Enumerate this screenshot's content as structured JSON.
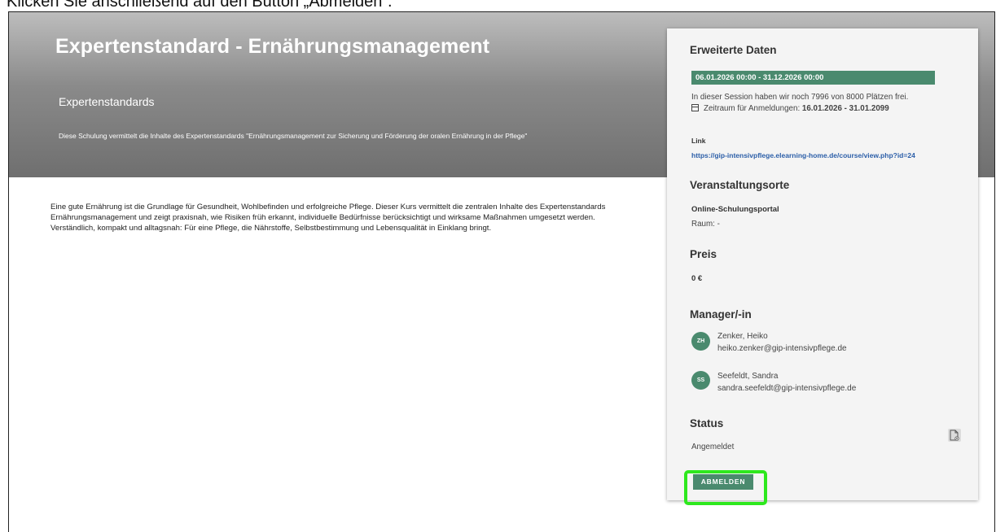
{
  "instruction": "Klicken Sie anschließend auf den Button „Abmelden“.",
  "hero": {
    "title": "Expertenstandard - Ernährungsmanagement",
    "subtitle": "Expertenstandards",
    "description": "Diese Schulung vermittelt die Inhalte des Expertenstandards \"Ernährungsmanagement zur Sicherung und Förderung der oralen Ernährung in der Pflege\""
  },
  "body_text": "Eine gute Ernährung ist die Grundlage für Gesundheit, Wohlbefinden und erfolgreiche Pflege. Dieser Kurs vermittelt die zentralen Inhalte des Expertenstandards Ernährungsmanagement und zeigt praxisnah, wie Risiken früh erkannt, individuelle Bedürfnisse berücksichtigt und wirksame Maßnahmen umgesetzt werden. Verständlich, kompakt und alltagsnah: Für eine Pflege, die Nährstoffe, Selbstbestimmung und Lebensqualität in Einklang bringt.",
  "panel": {
    "extended_heading": "Erweiterte Daten",
    "date_range": "06.01.2026 00:00 - 31.12.2026 00:00",
    "seats_text": "In dieser Session haben wir noch 7996 von 8000 Plätzen frei.",
    "registration_label": "Zeitraum für Anmeldungen: ",
    "registration_period": "16.01.2026 - 31.01.2099",
    "link_label": "Link",
    "link_url": "https://gip-intensivpflege.elearning-home.de/course/view.php?id=24",
    "venues_heading": "Veranstaltungsorte",
    "venue_name": "Online-Schulungsportal",
    "room": "Raum: -",
    "price_heading": "Preis",
    "price": "0 €",
    "manager_heading": "Manager/-in",
    "managers": [
      {
        "initials": "ZH",
        "name": "Zenker, Heiko",
        "email": "heiko.zenker@gip-intensivpflege.de"
      },
      {
        "initials": "SS",
        "name": "Seefeldt, Sandra",
        "email": "sandra.seefeldt@gip-intensivpflege.de"
      }
    ],
    "status_heading": "Status",
    "status_value": "Angemeldet",
    "unsubscribe_button": "ABMELDEN",
    "document_icon": "document-icon"
  },
  "colors": {
    "accent_green": "#4a8a6e",
    "link_blue": "#2b5ea8",
    "highlight_green": "#2ee81e"
  }
}
